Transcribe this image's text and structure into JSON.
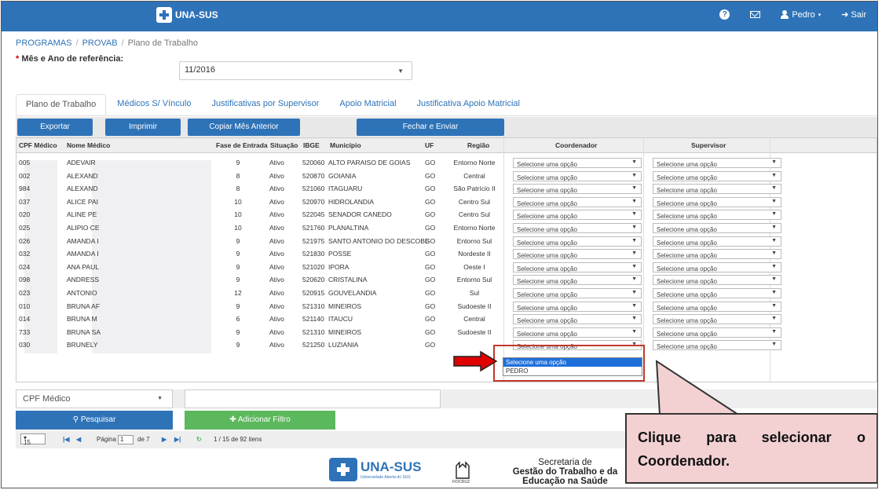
{
  "navbar": {
    "brand": "UNA-SUS",
    "user": "Pedro",
    "logout": "Sair",
    "help_icon": "help-icon",
    "mail_icon": "mail-icon",
    "user_icon": "user-icon",
    "logout_icon": "logout-icon"
  },
  "breadcrumb": {
    "items": [
      "PROGRAMAS",
      "PROVAB",
      "Plano de Trabalho"
    ],
    "separator": "/"
  },
  "month": {
    "label": "Mês e Ano de referência:",
    "required_mark": "*",
    "value": "11/2016"
  },
  "tabs": [
    {
      "label": "Plano de Trabalho",
      "active": true
    },
    {
      "label": "Médicos S/ Vínculo",
      "active": false
    },
    {
      "label": "Justificativas por Supervisor",
      "active": false
    },
    {
      "label": "Apoio Matricial",
      "active": false
    },
    {
      "label": "Justificativa Apoio Matricial",
      "active": false
    }
  ],
  "actions": {
    "export": "Exportar",
    "print": "Imprimir",
    "copy": "Copiar Mês Anterior",
    "close": "Fechar e Enviar"
  },
  "table": {
    "headers": [
      "CPF Médico",
      "Nome Médico",
      "Fase de Entrada",
      "Situação",
      "IBGE",
      "Município",
      "UF",
      "Região",
      "Coordenador",
      "Supervisor"
    ],
    "select_placeholder": "Selecione uma opção",
    "rows": [
      {
        "cpf": "005",
        "nome": "ADEVAIR",
        "fase": "9",
        "situacao": "Ativo",
        "ibge": "520060",
        "municipio": "ALTO PARAISO DE GOIAS",
        "uf": "GO",
        "regiao": "Entorno Norte"
      },
      {
        "cpf": "002",
        "nome": "ALEXAND",
        "fase": "8",
        "situacao": "Ativo",
        "ibge": "520870",
        "municipio": "GOIANIA",
        "uf": "GO",
        "regiao": "Central"
      },
      {
        "cpf": "984",
        "nome": "ALEXAND",
        "fase": "8",
        "situacao": "Ativo",
        "ibge": "521060",
        "municipio": "ITAGUARU",
        "uf": "GO",
        "regiao": "São Patrício II"
      },
      {
        "cpf": "037",
        "nome": "ALICE PAI",
        "fase": "10",
        "situacao": "Ativo",
        "ibge": "520970",
        "municipio": "HIDROLANDIA",
        "uf": "GO",
        "regiao": "Centro Sul"
      },
      {
        "cpf": "020",
        "nome": "ALINE PE",
        "fase": "10",
        "situacao": "Ativo",
        "ibge": "522045",
        "municipio": "SENADOR CANEDO",
        "uf": "GO",
        "regiao": "Centro Sul"
      },
      {
        "cpf": "025",
        "nome": "ALIPIO CE",
        "fase": "10",
        "situacao": "Ativo",
        "ibge": "521760",
        "municipio": "PLANALTINA",
        "uf": "GO",
        "regiao": "Entorno Norte"
      },
      {
        "cpf": "026",
        "nome": "AMANDA I",
        "fase": "9",
        "situacao": "Ativo",
        "ibge": "521975",
        "municipio": "SANTO ANTONIO DO DESCOBE",
        "uf": "GO",
        "regiao": "Entorno Sul"
      },
      {
        "cpf": "032",
        "nome": "AMANDA I",
        "fase": "9",
        "situacao": "Ativo",
        "ibge": "521830",
        "municipio": "POSSE",
        "uf": "GO",
        "regiao": "Nordeste II"
      },
      {
        "cpf": "024",
        "nome": "ANA PAUL",
        "fase": "9",
        "situacao": "Ativo",
        "ibge": "521020",
        "municipio": "IPORA",
        "uf": "GO",
        "regiao": "Oeste I"
      },
      {
        "cpf": "098",
        "nome": "ANDRESS",
        "fase": "9",
        "situacao": "Ativo",
        "ibge": "520620",
        "municipio": "CRISTALINA",
        "uf": "GO",
        "regiao": "Entorno Sul"
      },
      {
        "cpf": "023",
        "nome": "ANTONIO",
        "fase": "12",
        "situacao": "Ativo",
        "ibge": "520915",
        "municipio": "GOUVELANDIA",
        "uf": "GO",
        "regiao": "Sul"
      },
      {
        "cpf": "010",
        "nome": "BRUNA AF",
        "fase": "9",
        "situacao": "Ativo",
        "ibge": "521310",
        "municipio": "MINEIROS",
        "uf": "GO",
        "regiao": "Sudoeste II"
      },
      {
        "cpf": "014",
        "nome": "BRUNA M",
        "fase": "6",
        "situacao": "Ativo",
        "ibge": "521140",
        "municipio": "ITAUCU",
        "uf": "GO",
        "regiao": "Central"
      },
      {
        "cpf": "733",
        "nome": "BRUNA SA",
        "fase": "9",
        "situacao": "Ativo",
        "ibge": "521310",
        "municipio": "MINEIROS",
        "uf": "GO",
        "regiao": "Sudoeste II"
      },
      {
        "cpf": "030",
        "nome": "BRUNELY",
        "fase": "9",
        "situacao": "Ativo",
        "ibge": "521250",
        "municipio": "LUZIANIA",
        "uf": "GO",
        "regiao": ""
      }
    ],
    "dropdown_options": [
      "Selecione uma opção",
      "PEDRO"
    ]
  },
  "filter": {
    "field": "CPF Médico",
    "search": "Pesquisar",
    "add_filter": "Adicionar Filtro"
  },
  "pager": {
    "page_size": "15",
    "page_label": "Página",
    "page": "1",
    "of": "de 7",
    "summary": "1 / 15 de 92 itens"
  },
  "footer": {
    "logo": "UNA-SUS",
    "logo_sub": "Universidade Aberta do SUS",
    "fiocruz": "FIOCRUZ",
    "secretaria_line1": "Secretaria de",
    "secretaria_line2": "Gestão do Trabalho e da",
    "secretaria_line3": "Educação na Saúde"
  },
  "annotation": {
    "text": "Clique para selecionar o Coordenador.",
    "box_color": "#f3d1d3",
    "arrow_color": "#e00000"
  }
}
